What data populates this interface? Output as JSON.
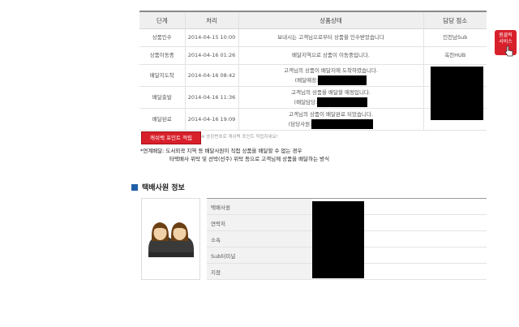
{
  "tracking_table": {
    "headers": [
      "단계",
      "처리",
      "상품상태",
      "담당 점소"
    ],
    "rows": [
      {
        "step": "상품인수",
        "time": "2014-04-15 10:00",
        "status": "보내시는 고객님으로부터 상품을 인수받았습니다",
        "office": "인천남Sub"
      },
      {
        "step": "상품이동중",
        "time": "2014-04-16 01:26",
        "status": "배달지역으로 상품이 이동중입니다.",
        "office": "옥천HUB"
      },
      {
        "step": "배달지도착",
        "time": "2014-04-16 08:42",
        "status": "고객님의 상품이 배달지에 도착하였습니다.",
        "sub": "(배달예정:",
        "office": ""
      },
      {
        "step": "배달출발",
        "time": "2014-04-16 11:36",
        "status": "고객님의 상품을 배달할 예정입니다.",
        "sub": "(배달담당:",
        "office": ""
      },
      {
        "step": "배달완료",
        "time": "2014-04-16 19:09",
        "status": "고객님의 상품이 배달완료 되었습니다.",
        "sub": "(담당사원:",
        "office": ""
      }
    ]
  },
  "cashback": {
    "button_label": "캐쉬백 포인트 적립",
    "note": "※ 송장번호로 캐쉬백 포인트 적립하세요!"
  },
  "notes": {
    "line1": "*연계배달: 도서외곽 지역 등 배달사원이 직접 상품을 배달할 수 없는 경우",
    "line2": "타택배사 위탁 및 선박(선주) 위탁 등으로 고객님께 상품을 배달하는 방식"
  },
  "floating_button": {
    "label_line1": "원클릭",
    "label_line2": "서비스"
  },
  "staff_section": {
    "title": "택배사원 정보",
    "labels": [
      "택배사원",
      "연락처",
      "소속",
      "Sub터미널",
      "지점"
    ]
  },
  "colors": {
    "accent_red": "#d8202b",
    "section_blue": "#1f5fa8",
    "header_bg": "#efefef"
  },
  "icons": [
    "section-square-icon",
    "staff-avatar-icon",
    "pointer-hand-icon"
  ]
}
